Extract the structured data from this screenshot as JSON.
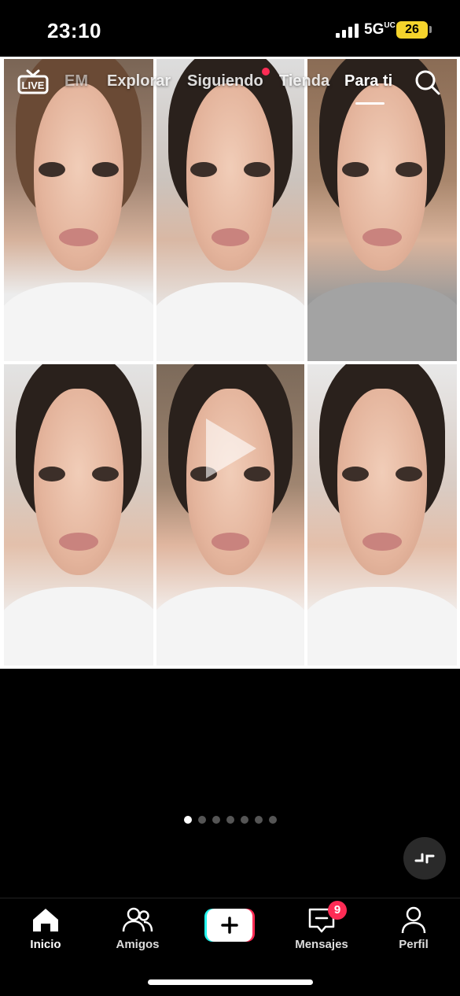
{
  "status_bar": {
    "time": "23:10",
    "network": "5G",
    "network_sub": "UC",
    "battery": "26"
  },
  "top_nav": {
    "tabs": [
      {
        "label": "EM",
        "state": "dim"
      },
      {
        "label": "Explorar",
        "state": "normal"
      },
      {
        "label": "Siguiendo",
        "state": "normal",
        "has_dot": true
      },
      {
        "label": "Tienda",
        "state": "normal"
      },
      {
        "label": "Para ti",
        "state": "active"
      }
    ],
    "live_label": "LIVE"
  },
  "photo_grid": {
    "tiles": [
      {
        "alt": "photo-1"
      },
      {
        "alt": "photo-2"
      },
      {
        "alt": "photo-3"
      },
      {
        "alt": "photo-4"
      },
      {
        "alt": "photo-5"
      },
      {
        "alt": "photo-6"
      }
    ]
  },
  "carousel": {
    "total_pages": 7,
    "active_index": 0
  },
  "tab_bar": {
    "items": [
      {
        "label": "Inicio",
        "icon": "home-icon",
        "active": true
      },
      {
        "label": "Amigos",
        "icon": "friends-icon",
        "active": false
      },
      {
        "label": "",
        "icon": "plus-icon",
        "active": false
      },
      {
        "label": "Mensajes",
        "icon": "messages-icon",
        "active": false
      },
      {
        "label": "Perfil",
        "icon": "profile-icon",
        "active": false
      }
    ],
    "messages_badge": "9"
  },
  "colors": {
    "accent_red": "#fe2c55",
    "accent_cyan": "#25f4ee",
    "battery_yellow": "#f5d42c"
  }
}
